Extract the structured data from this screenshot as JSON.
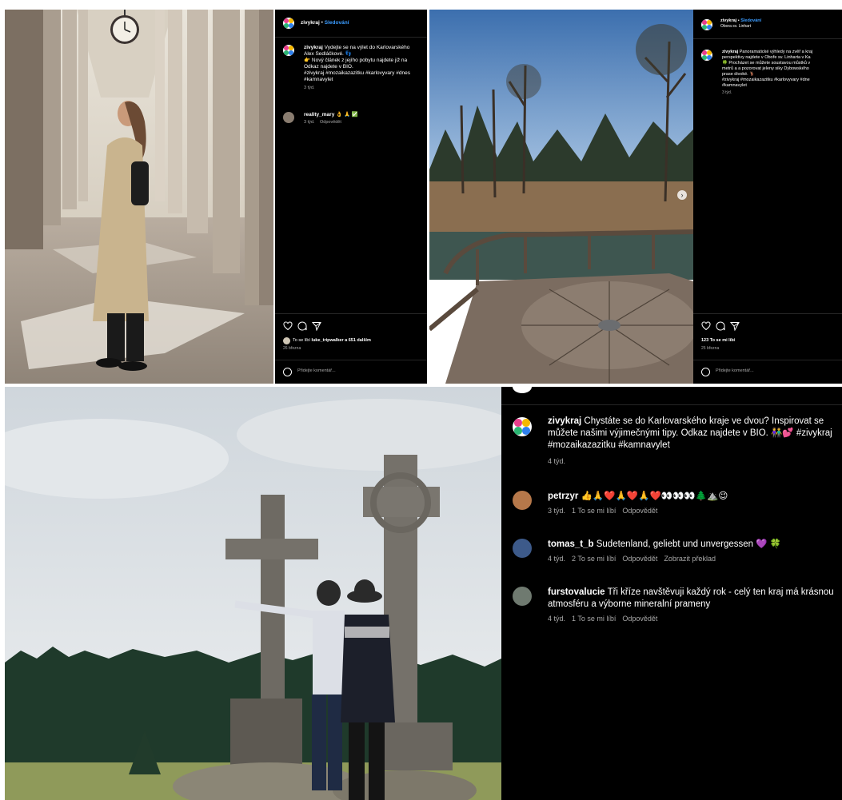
{
  "post1": {
    "username": "zivykraj",
    "follow": "Sledování",
    "caption_user": "zivykraj",
    "caption_lines": [
      "Vydejte se na výlet do Karlovarského",
      "Alex Sedláčkové. 👣",
      "👉 Nový článek z jejího pobytu najdete již na",
      "Odkaz najdete v BIO.",
      "#zivykraj #mozaikazazitku #karlovyvary #dnes",
      "#kamnavylet"
    ],
    "caption_time": "3 týd.",
    "comment_user": "reality_mary",
    "comment_emoji": "👌 🙏 ✅",
    "comment_time": "3 týd.",
    "comment_reply": "Odpovědět",
    "likes_prefix": "To se líbí",
    "likes_user": "luke_tripwalker",
    "likes_suffix": "a 651 dalším",
    "date": "26 března",
    "add_comment": "Přidejte komentář..."
  },
  "post2": {
    "username": "zivykraj",
    "follow": "Sledování",
    "location": "Obora sv. Linhart",
    "caption_user": "zivykraj",
    "caption_lines": [
      "Panoramatické výhledy na zvěř a kraj",
      "perspektivy najdete v Oboře sv. Linharta v Ka",
      "🍀 Procházet se můžete soustavou můstků v",
      "metrů a a pozorovat jeleny siky Dybowského",
      "prase divoké. 🦌",
      "#zivykraj #mozaikazazitku #karlovyvary #dne",
      "#kamnavylet"
    ],
    "caption_time": "3 týd.",
    "likes": "123 To se mi líbí",
    "date": "25 března",
    "add_comment": "Přidejte komentář..."
  },
  "post3": {
    "caption_user": "zivykraj",
    "caption_text": "Chystáte se do Karlovarského kraje ve dvou? Inspirovat se můžete našimi výjimečnými tipy. Odkaz najdete v BIO. 👫💕 #zivykraj #mozaikazazitku #kamnavylet",
    "caption_time": "4 týd.",
    "comments": [
      {
        "user": "petrzyr",
        "text": "👍🙏❤️🙏❤️🙏❤️👀👀👀🌲⛰️😉",
        "time": "3 týd.",
        "likes": "1 To se mi líbí",
        "reply": "Odpovědět",
        "extra": ""
      },
      {
        "user": "tomas_t_b",
        "text": "Sudetenland, geliebt und unvergessen 💜 🍀",
        "time": "4 týd.",
        "likes": "2 To se mi líbí",
        "reply": "Odpovědět",
        "extra": "Zobrazit překlad"
      },
      {
        "user": "furstovalucie",
        "text": "Tři kříze navštěvuji každý rok - celý ten kraj má krásnou atmosféru a výborne mineralní prameny",
        "time": "4 týd.",
        "likes": "1 To se mi líbí",
        "reply": "Odpovědět",
        "extra": ""
      }
    ]
  },
  "icons": [
    "heart-icon",
    "comment-icon",
    "share-icon",
    "emoji-icon",
    "next-arrow-icon",
    "previous-arrow-icon"
  ],
  "colors": {
    "panel_bg": "#000000",
    "follow_blue": "#3b9cff",
    "meta_grey": "#a8a8a8"
  }
}
